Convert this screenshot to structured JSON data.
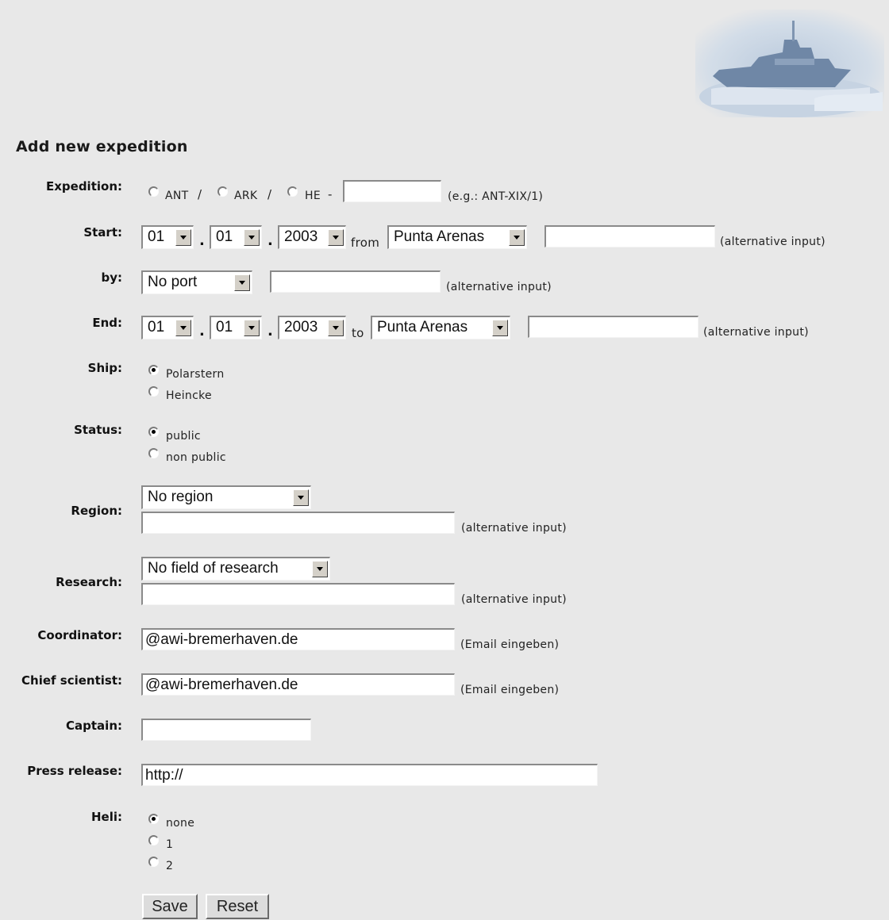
{
  "page": {
    "title": "Add new expedition"
  },
  "expedition": {
    "label": "Expedition:",
    "options": [
      "ANT",
      "ARK",
      "HE"
    ],
    "sep1": "/",
    "sep2": "/",
    "sep3": "-",
    "value": "",
    "hint": "(e.g.: ANT-XIX/1)"
  },
  "start": {
    "label": "Start:",
    "day": "01",
    "month": "01",
    "year": "2003",
    "from_text": "from",
    "port": "Punta Arenas",
    "alt_value": "",
    "hint": "(alternative input)"
  },
  "by": {
    "label": "by:",
    "port": "No port",
    "alt_value": "",
    "hint": "(alternative input)"
  },
  "end": {
    "label": "End:",
    "day": "01",
    "month": "01",
    "year": "2003",
    "to_text": "to",
    "port": "Punta Arenas",
    "alt_value": "",
    "hint": "(alternative input)"
  },
  "ship": {
    "label": "Ship:",
    "options": [
      "Polarstern",
      "Heincke"
    ],
    "selected": "Polarstern"
  },
  "status": {
    "label": "Status:",
    "options": [
      "public",
      "non public"
    ],
    "selected": "public"
  },
  "region": {
    "label": "Region:",
    "selected": "No region",
    "alt_value": "",
    "hint": "(alternative input)"
  },
  "research": {
    "label": "Research:",
    "selected": "No field of research",
    "alt_value": "",
    "hint": "(alternative input)"
  },
  "coordinator": {
    "label": "Coordinator:",
    "value": "@awi-bremerhaven.de",
    "hint": "(Email eingeben)"
  },
  "chief": {
    "label": "Chief scientist:",
    "value": "@awi-bremerhaven.de",
    "hint": "(Email eingeben)"
  },
  "captain": {
    "label": "Captain:",
    "value": ""
  },
  "press": {
    "label": "Press release:",
    "value": "http://"
  },
  "heli": {
    "label": "Heli:",
    "options": [
      "none",
      "1",
      "2"
    ],
    "selected": "none"
  },
  "buttons": {
    "save": "Save",
    "reset": "Reset"
  },
  "colors": {
    "background": "#e8e8e8",
    "field": "#ffffff",
    "button": "#dcdcdc"
  }
}
